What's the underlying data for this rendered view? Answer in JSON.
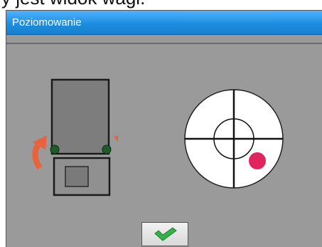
{
  "header_caption": {
    "text": "y jest widok wagi."
  },
  "window": {
    "title": "Poziomowanie"
  },
  "icons": {
    "scale_diagram": "scale-top-view-icon",
    "rotate_left": "rotate-left-arrow-icon",
    "rotate_right": "rotate-right-arrow-icon",
    "level": "bubble-level-icon",
    "confirm": "checkmark-icon"
  },
  "level": {
    "bubble_color": "#e0245e",
    "bubble_position": "lower-right"
  },
  "colors": {
    "title_bar": "#1d8ee0",
    "panel_background": "#9a9a9a",
    "arrow": "#e8623c",
    "checkmark": "#35b14a"
  }
}
